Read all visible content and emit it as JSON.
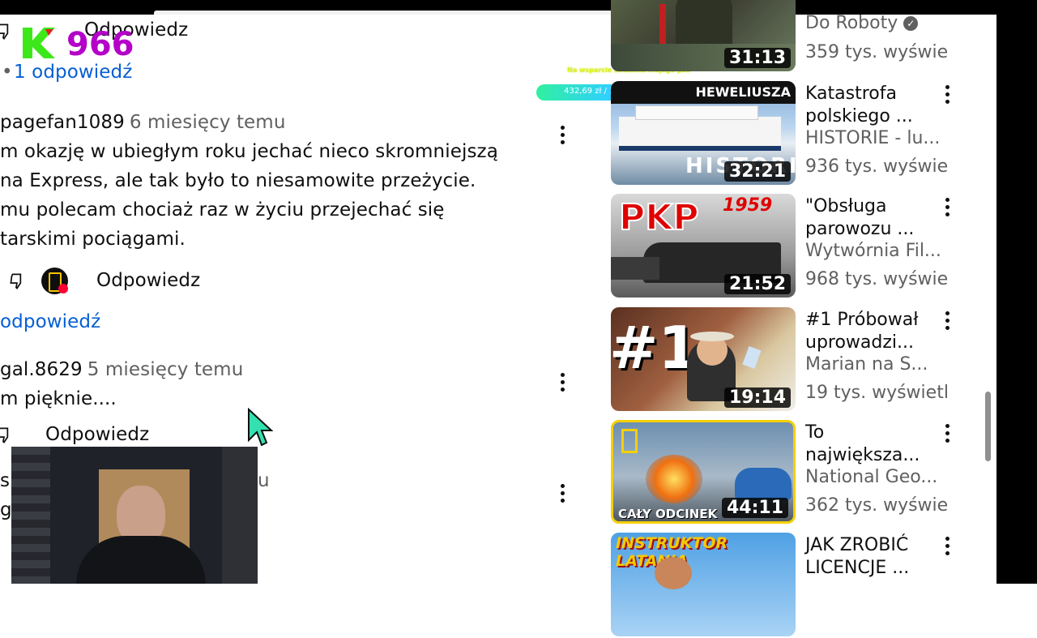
{
  "comments": [
    {
      "reply_label": "Odpowiedz",
      "replies_link": "1 odpowiedź"
    },
    {
      "author": "pagefan1089",
      "time": "6 miesięcy temu",
      "lines": [
        "m okazję w ubiegłym roku jechać nieco skromniejszą",
        "na Express, ale tak było to niesamowite przeżycie.",
        "mu polecam chociaż raz w życiu przejechać się",
        "tarskimi pociągami."
      ],
      "reply_label": "Odpowiedz",
      "replies_link": "odpowiedź"
    },
    {
      "author": "gal.8629",
      "time": "5 miesięcy temu",
      "lines": [
        "m pięknie...."
      ],
      "reply_label": "Odpowiedz"
    },
    {
      "partial_left_1": "s",
      "partial_right_1": "u",
      "partial_left_2": "g"
    }
  ],
  "overlays": {
    "counter": "966",
    "donation_title": "Na wsparcie Leczenia mojego psa",
    "donation_progress_text": "432,69 zł / 1000,00 zł (43.27%)",
    "donation_progress": 0.4327
  },
  "videos": [
    {
      "title": "",
      "channel": "Do Roboty",
      "verified": true,
      "views": "359 tys. wyświe",
      "duration": "31:13"
    },
    {
      "title": "Katastrofa polskiego ...",
      "thumb_text": "HISTORIE",
      "thumb_banner": "HEWELIUSZA",
      "channel": "HISTORIE - lu...",
      "views": "936 tys. wyświe",
      "duration": "32:21"
    },
    {
      "title": "\"Obsługa parowozu ...",
      "thumb_text": "PKP",
      "thumb_year": "1959",
      "channel": "Wytwórnia Fil...",
      "views": "968 tys. wyświe",
      "duration": "21:52"
    },
    {
      "title": "#1 Próbował uprowadzi...",
      "thumb_text": "#1",
      "channel": "Marian na S...",
      "views": "19 tys. wyświetl",
      "duration": "19:14"
    },
    {
      "title": "To największa...",
      "thumb_text": "CAŁY ODCINEK",
      "channel": "National Geo...",
      "views": "362 tys. wyświe",
      "duration": "44:11"
    },
    {
      "title": "JAK ZROBIĆ LICENCJE ...",
      "thumb_text": "INSTRUKTOR LATANIA",
      "channel": "",
      "views": "",
      "duration": ""
    }
  ],
  "colors": {
    "link": "#065fd4",
    "secondary_text": "#606060",
    "counter": "#b400c8"
  }
}
